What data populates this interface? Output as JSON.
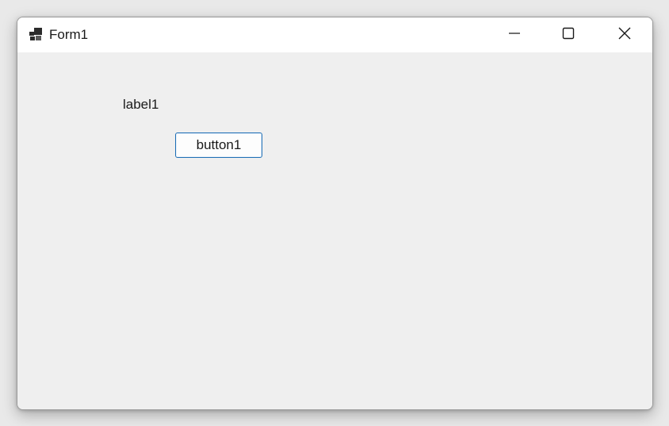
{
  "window": {
    "title": "Form1",
    "app_icon": "form-app-icon",
    "controls": {
      "minimize_icon": "minimize-icon",
      "maximize_icon": "maximize-icon",
      "close_icon": "close-icon"
    }
  },
  "form": {
    "label1_text": "label1",
    "button1_label": "button1"
  },
  "colors": {
    "titlebar": "#ffffff",
    "client_background": "#efefef",
    "button_border": "#1f6fb5"
  }
}
